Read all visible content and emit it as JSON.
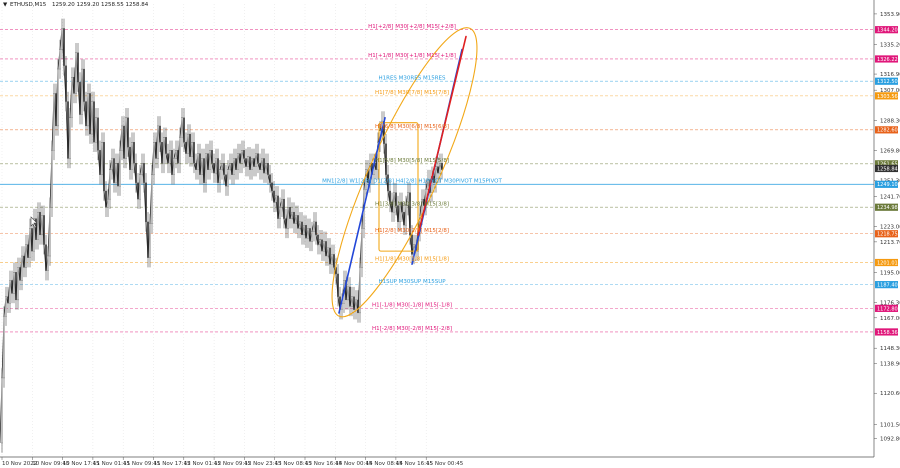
{
  "window": {
    "menu_arrow": "▼",
    "symbol_timeframe": "ETHUSD,M15",
    "ohlc": "1259.20 1259.20 1258.55 1258.84"
  },
  "icons": {
    "menu": "triangle-down-icon",
    "cursor": "cursor-arrow-icon"
  },
  "colors": {
    "candles": "#2b2b2b",
    "magenta": "#e0177a",
    "orange": "#f59a10",
    "orange_dark": "#e8621a",
    "blue_level": "#2a9fe0",
    "olive": "#6b7a3a",
    "blue_trend": "#2347d8",
    "red_trend": "#e02020",
    "ellipse": "#f2a818",
    "grid": "#d9d9d9"
  },
  "chart_data": {
    "type": "candlestick",
    "symbol": "ETHUSD",
    "timeframe": "M15",
    "grid": false,
    "ylim": [
      1082.0,
      1360.0
    ],
    "y_ticks": [
      "1353.90",
      "1335.20",
      "1316.90",
      "1307.00",
      "1288.30",
      "1269.80",
      "1251.30",
      "1241.70",
      "1223.00",
      "1213.70",
      "1195.00",
      "1176.30",
      "1167.00",
      "1148.30",
      "1138.90",
      "1120.60",
      "1101.50",
      "1092.80"
    ],
    "y_tick_values": [
      1353.9,
      1335.2,
      1316.9,
      1307.0,
      1288.3,
      1269.8,
      1251.3,
      1241.7,
      1223.0,
      1213.7,
      1195.0,
      1176.3,
      1167.0,
      1148.3,
      1138.9,
      1120.6,
      1101.5,
      1092.8
    ],
    "x_ticks": [
      "10 Nov 2022",
      "10 Nov 09:45",
      "10 Nov 17:45",
      "11 Nov 01:45",
      "11 Nov 09:45",
      "11 Nov 17:45",
      "12 Nov 01:45",
      "12 Nov 09:45",
      "12 Nov 23:45",
      "13 Nov 08:45",
      "13 Nov 16:45",
      "14 Nov 00:45",
      "14 Nov 08:45",
      "14 Nov 16:45",
      "15 Nov 00:45"
    ],
    "close_path": [
      [
        0,
        1090
      ],
      [
        2,
        1130
      ],
      [
        4,
        1168
      ],
      [
        6,
        1180
      ],
      [
        8,
        1176
      ],
      [
        10,
        1190
      ],
      [
        12,
        1182
      ],
      [
        14,
        1195
      ],
      [
        16,
        1178
      ],
      [
        18,
        1198
      ],
      [
        20,
        1190
      ],
      [
        22,
        1205
      ],
      [
        24,
        1198
      ],
      [
        26,
        1212
      ],
      [
        28,
        1204
      ],
      [
        30,
        1222
      ],
      [
        32,
        1208
      ],
      [
        34,
        1228
      ],
      [
        36,
        1215
      ],
      [
        38,
        1232
      ],
      [
        40,
        1218
      ],
      [
        42,
        1230
      ],
      [
        44,
        1212
      ],
      [
        46,
        1196
      ],
      [
        48,
        1205
      ],
      [
        50,
        1235
      ],
      [
        52,
        1270
      ],
      [
        54,
        1305
      ],
      [
        56,
        1285
      ],
      [
        58,
        1320
      ],
      [
        60,
        1332
      ],
      [
        62,
        1345
      ],
      [
        64,
        1322
      ],
      [
        66,
        1300
      ],
      [
        68,
        1265
      ],
      [
        70,
        1290
      ],
      [
        72,
        1315
      ],
      [
        74,
        1305
      ],
      [
        76,
        1330
      ],
      [
        78,
        1312
      ],
      [
        80,
        1292
      ],
      [
        82,
        1320
      ],
      [
        84,
        1300
      ],
      [
        86,
        1285
      ],
      [
        88,
        1305
      ],
      [
        90,
        1280
      ],
      [
        92,
        1300
      ],
      [
        94,
        1275
      ],
      [
        96,
        1290
      ],
      [
        98,
        1270
      ],
      [
        100,
        1255
      ],
      [
        102,
        1275
      ],
      [
        104,
        1245
      ],
      [
        106,
        1235
      ],
      [
        108,
        1240
      ],
      [
        110,
        1258
      ],
      [
        112,
        1265
      ],
      [
        114,
        1250
      ],
      [
        116,
        1262
      ],
      [
        118,
        1248
      ],
      [
        120,
        1270
      ],
      [
        122,
        1285
      ],
      [
        124,
        1265
      ],
      [
        126,
        1290
      ],
      [
        128,
        1272
      ],
      [
        130,
        1258
      ],
      [
        132,
        1275
      ],
      [
        134,
        1262
      ],
      [
        136,
        1250
      ],
      [
        138,
        1240
      ],
      [
        140,
        1255
      ],
      [
        142,
        1262
      ],
      [
        144,
        1250
      ],
      [
        146,
        1226
      ],
      [
        148,
        1204
      ],
      [
        150,
        1225
      ],
      [
        152,
        1255
      ],
      [
        154,
        1275
      ],
      [
        156,
        1265
      ],
      [
        158,
        1285
      ],
      [
        160,
        1275
      ],
      [
        162,
        1262
      ],
      [
        164,
        1278
      ],
      [
        166,
        1268
      ],
      [
        168,
        1262
      ],
      [
        170,
        1270
      ],
      [
        172,
        1255
      ],
      [
        174,
        1265
      ],
      [
        176,
        1270
      ],
      [
        178,
        1262
      ],
      [
        180,
        1278
      ],
      [
        182,
        1290
      ],
      [
        184,
        1275
      ],
      [
        186,
        1268
      ],
      [
        188,
        1280
      ],
      [
        190,
        1266
      ],
      [
        192,
        1275
      ],
      [
        194,
        1262
      ],
      [
        196,
        1258
      ],
      [
        198,
        1268
      ],
      [
        200,
        1255
      ],
      [
        202,
        1265
      ],
      [
        204,
        1250
      ],
      [
        206,
        1268
      ],
      [
        208,
        1258
      ],
      [
        210,
        1270
      ],
      [
        212,
        1262
      ],
      [
        214,
        1256
      ],
      [
        216,
        1265
      ],
      [
        218,
        1250
      ],
      [
        220,
        1258
      ],
      [
        222,
        1262
      ],
      [
        224,
        1255
      ],
      [
        226,
        1248
      ],
      [
        228,
        1258
      ],
      [
        230,
        1262
      ],
      [
        232,
        1255
      ],
      [
        234,
        1265
      ],
      [
        236,
        1258
      ],
      [
        238,
        1268
      ],
      [
        240,
        1262
      ],
      [
        242,
        1270
      ],
      [
        244,
        1265
      ],
      [
        246,
        1260
      ],
      [
        248,
        1266
      ],
      [
        250,
        1258
      ],
      [
        252,
        1265
      ],
      [
        254,
        1260
      ],
      [
        256,
        1268
      ],
      [
        258,
        1262
      ],
      [
        260,
        1258
      ],
      [
        262,
        1265
      ],
      [
        264,
        1256
      ],
      [
        266,
        1262
      ],
      [
        268,
        1255
      ],
      [
        270,
        1250
      ],
      [
        272,
        1245
      ],
      [
        274,
        1238
      ],
      [
        276,
        1242
      ],
      [
        278,
        1228
      ],
      [
        280,
        1235
      ],
      [
        282,
        1240
      ],
      [
        284,
        1228
      ],
      [
        286,
        1222
      ],
      [
        288,
        1235
      ],
      [
        290,
        1228
      ],
      [
        292,
        1232
      ],
      [
        294,
        1225
      ],
      [
        296,
        1230
      ],
      [
        298,
        1222
      ],
      [
        300,
        1226
      ],
      [
        302,
        1218
      ],
      [
        304,
        1224
      ],
      [
        306,
        1216
      ],
      [
        308,
        1222
      ],
      [
        310,
        1214
      ],
      [
        312,
        1220
      ],
      [
        314,
        1226
      ],
      [
        316,
        1218
      ],
      [
        318,
        1212
      ],
      [
        320,
        1215
      ],
      [
        322,
        1208
      ],
      [
        324,
        1214
      ],
      [
        326,
        1205
      ],
      [
        328,
        1210
      ],
      [
        330,
        1200
      ],
      [
        332,
        1206
      ],
      [
        334,
        1198
      ],
      [
        336,
        1194
      ],
      [
        338,
        1180
      ],
      [
        340,
        1172
      ],
      [
        342,
        1176
      ],
      [
        344,
        1190
      ],
      [
        346,
        1178
      ],
      [
        348,
        1186
      ],
      [
        350,
        1174
      ],
      [
        352,
        1180
      ],
      [
        354,
        1172
      ],
      [
        356,
        1178
      ],
      [
        358,
        1170
      ],
      [
        360,
        1198
      ],
      [
        362,
        1222
      ],
      [
        364,
        1246
      ],
      [
        366,
        1258
      ],
      [
        368,
        1250
      ],
      [
        370,
        1262
      ],
      [
        372,
        1255
      ],
      [
        374,
        1262
      ],
      [
        376,
        1258
      ],
      [
        378,
        1275
      ],
      [
        380,
        1282
      ],
      [
        382,
        1288
      ],
      [
        384,
        1274
      ],
      [
        386,
        1255
      ],
      [
        388,
        1245
      ],
      [
        390,
        1238
      ],
      [
        392,
        1232
      ],
      [
        394,
        1244
      ],
      [
        396,
        1236
      ],
      [
        398,
        1226
      ],
      [
        400,
        1238
      ],
      [
        402,
        1232
      ],
      [
        404,
        1224
      ],
      [
        406,
        1236
      ],
      [
        408,
        1244
      ],
      [
        410,
        1218
      ],
      [
        412,
        1206
      ],
      [
        414,
        1212
      ],
      [
        416,
        1208
      ],
      [
        418,
        1220
      ],
      [
        420,
        1230
      ],
      [
        422,
        1240
      ],
      [
        424,
        1236
      ],
      [
        426,
        1246
      ],
      [
        428,
        1252
      ],
      [
        430,
        1244
      ],
      [
        432,
        1254
      ],
      [
        434,
        1250
      ],
      [
        436,
        1260
      ],
      [
        438,
        1256
      ],
      [
        440,
        1262
      ],
      [
        442,
        1258
      ]
    ],
    "price_levels": [
      {
        "label": "H1[+2/8] M30[+2/8] M15[+2/8]",
        "price": 1344.2,
        "color_key": "magenta",
        "tag": "1344.20"
      },
      {
        "label": "H1[+1/8] M30[+1/8] M15[+1/8]",
        "price": 1326.2,
        "color_key": "magenta",
        "tag": "1326.22"
      },
      {
        "label": "H1RES M30RES M15RES",
        "price": 1312.5,
        "color_key": "blue_level",
        "tag": "1312.50"
      },
      {
        "label": "H1[7/8] M30[7/8] M15[7/8]",
        "price": 1303.5,
        "color_key": "orange",
        "tag": "1303.56"
      },
      {
        "label": "H1[6/8] M30[6/8] M15[6/8]",
        "price": 1282.6,
        "color_key": "orange_dark",
        "tag": "1282.60"
      },
      {
        "label": "H1[5/8] M30[5/8] M15[5/8]",
        "price": 1261.7,
        "color_key": "olive",
        "tag": "1261.65"
      },
      {
        "label": "MN1[2/8] W1[2/8] D1[2/8] H4[2/8] H1PIVOT M30PIVOT M15PIVOT",
        "price": 1249.1,
        "color_key": "blue_level",
        "tag": "1249.10"
      },
      {
        "label": "H1[3/8] M30[3/8] M15[3/8]",
        "price": 1235.0,
        "color_key": "olive",
        "tag": "1234.98"
      },
      {
        "label": "H1[2/8] M30[2/8] M15[2/8]",
        "price": 1218.7,
        "color_key": "orange_dark",
        "tag": "1218.75"
      },
      {
        "label": "H1[1/8] M30[1/8] M15[1/8]",
        "price": 1201.0,
        "color_key": "orange",
        "tag": "1201.01"
      },
      {
        "label": "H1SUP M30SUP M15SUP",
        "price": 1187.4,
        "color_key": "blue_level",
        "tag": "1187.40"
      },
      {
        "label": "H1[-1/8] M30[-1/8] M15[-1/8]",
        "price": 1172.8,
        "color_key": "magenta",
        "tag": "1172.80"
      },
      {
        "label": "H1[-2/8] M30[-2/8] M15[-2/8]",
        "price": 1158.3,
        "color_key": "magenta",
        "tag": "1158.36"
      }
    ],
    "current_price_tag": "1258.84",
    "annotations": {
      "trend_lines": [
        {
          "color_key": "blue_trend",
          "from": [
            339,
            1170
          ],
          "to": [
            385,
            1290
          ]
        },
        {
          "color_key": "blue_trend",
          "from": [
            412,
            1200
          ],
          "to": [
            462,
            1332
          ]
        },
        {
          "color_key": "red_trend",
          "from": [
            418,
            1218
          ],
          "to": [
            466,
            1340
          ]
        }
      ],
      "ellipse": {
        "from": [
          339,
          1168
        ],
        "to": [
          470,
          1345
        ]
      },
      "box": {
        "x0": 379,
        "x1": 418,
        "p_top": 1287,
        "p_bottom": 1208
      }
    }
  }
}
